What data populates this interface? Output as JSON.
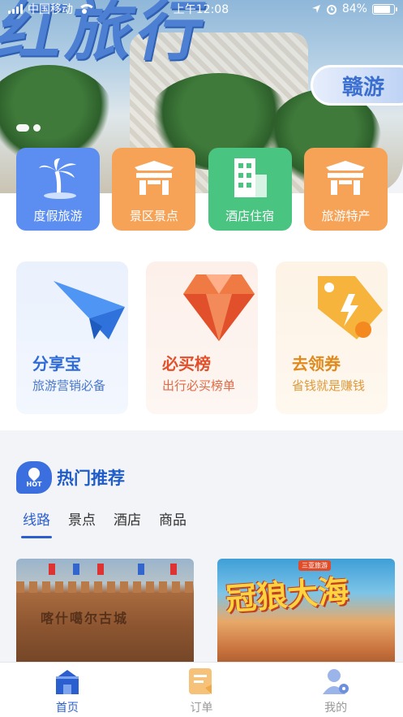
{
  "status_bar": {
    "carrier": "中国移动",
    "time": "上午12:08",
    "battery": "84%",
    "battery_level": 0.84,
    "icons": [
      "signal-icon",
      "wifi-icon",
      "location-icon",
      "alarm-icon",
      "battery-icon"
    ]
  },
  "banner": {
    "headline": "红旅行",
    "pill_text": "赣游",
    "slide_count": 2,
    "active_slide": 1
  },
  "categories": [
    {
      "label": "度假旅游",
      "icon": "palm-tree-icon",
      "color": "#5b8ef0"
    },
    {
      "label": "景区景点",
      "icon": "gate-icon",
      "color": "#f6a257"
    },
    {
      "label": "酒店住宿",
      "icon": "hotel-icon",
      "color": "#49c481"
    },
    {
      "label": "旅游特产",
      "icon": "gate-icon",
      "color": "#f6a257"
    }
  ],
  "promos": [
    {
      "title": "分享宝",
      "subtitle": "旅游营销必备",
      "icon": "paper-plane-icon",
      "title_color": "#2f6bd6",
      "sub_color": "#4a78cc",
      "bg": "#eaf1fd"
    },
    {
      "title": "必买榜",
      "subtitle": "出行必买榜单",
      "icon": "diamond-icon",
      "title_color": "#e2502b",
      "sub_color": "#e06a47",
      "bg": "#fdf0ea"
    },
    {
      "title": "去领券",
      "subtitle": "省钱就是赚钱",
      "icon": "coupon-tag-icon",
      "title_color": "#e08a1c",
      "sub_color": "#e09a3c",
      "bg": "#fdf3e6"
    }
  ],
  "hot": {
    "badge": "HOT",
    "title": "热门推荐",
    "tabs": [
      "线路",
      "景点",
      "酒店",
      "商品"
    ],
    "active_tab": 0
  },
  "thumbs": [
    {
      "caption": "喀什噶尔古城"
    },
    {
      "title": "冠狼大海",
      "tag": "三亚旅游"
    }
  ],
  "tabbar": [
    {
      "label": "首页",
      "icon": "home-icon",
      "active": true
    },
    {
      "label": "订单",
      "icon": "order-icon",
      "active": false
    },
    {
      "label": "我的",
      "icon": "user-icon",
      "active": false
    }
  ],
  "colors": {
    "accent": "#2b5fd0",
    "page_bg": "#f2f4f8"
  }
}
